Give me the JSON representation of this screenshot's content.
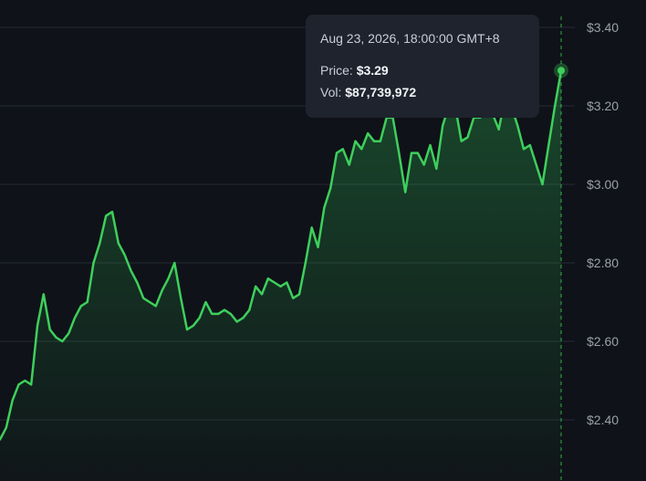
{
  "chart_data": {
    "type": "area",
    "ylim": [
      2.2,
      3.42
    ],
    "yticks": [
      2.4,
      2.6,
      2.8,
      3.0,
      3.2,
      3.4
    ],
    "ytick_labels": [
      "$2.40",
      "$2.60",
      "$2.80",
      "$3.00",
      "$3.20",
      "$3.40"
    ],
    "grid": true,
    "series": [
      {
        "color": "#3ecf5c",
        "values": [
          2.35,
          2.38,
          2.45,
          2.49,
          2.5,
          2.49,
          2.64,
          2.72,
          2.63,
          2.61,
          2.6,
          2.62,
          2.66,
          2.69,
          2.7,
          2.8,
          2.85,
          2.92,
          2.93,
          2.85,
          2.82,
          2.78,
          2.75,
          2.71,
          2.7,
          2.69,
          2.73,
          2.76,
          2.8,
          2.71,
          2.63,
          2.64,
          2.66,
          2.7,
          2.67,
          2.67,
          2.68,
          2.67,
          2.65,
          2.66,
          2.68,
          2.74,
          2.72,
          2.76,
          2.75,
          2.74,
          2.75,
          2.71,
          2.72,
          2.8,
          2.89,
          2.84,
          2.94,
          2.99,
          3.08,
          3.09,
          3.05,
          3.11,
          3.09,
          3.13,
          3.11,
          3.11,
          3.17,
          3.17,
          3.08,
          2.98,
          3.08,
          3.08,
          3.05,
          3.1,
          3.04,
          3.15,
          3.2,
          3.2,
          3.11,
          3.12,
          3.17,
          3.17,
          3.21,
          3.18,
          3.14,
          3.22,
          3.2,
          3.15,
          3.09,
          3.1,
          3.05,
          3.0,
          3.1,
          3.2,
          3.29
        ]
      }
    ],
    "crosshair_index": 90
  },
  "tooltip": {
    "date": "Aug 23, 2026, 18:00:00 GMT+8",
    "price_label": "Price: ",
    "price_value": "$3.29",
    "vol_label": "Vol: ",
    "vol_value": "$87,739,972"
  },
  "colors": {
    "background": "#0f1218",
    "grid": "#252a33",
    "line": "#3ecf5c",
    "axis_text": "#9aa0ab",
    "tooltip_bg": "#1e232d"
  }
}
